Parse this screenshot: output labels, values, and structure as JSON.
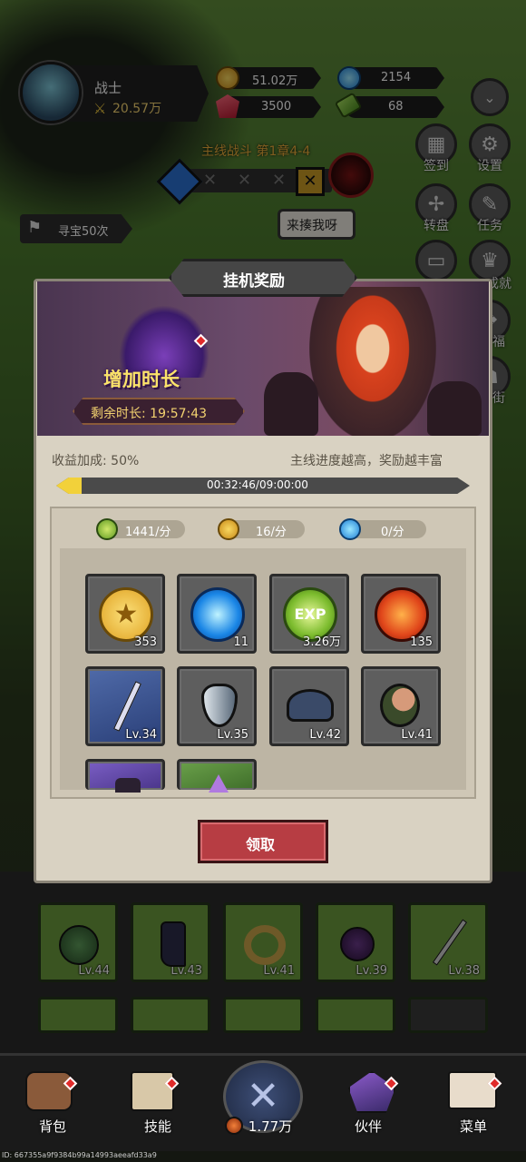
{
  "player": {
    "name": "战士",
    "power": "20.57万"
  },
  "currencies": {
    "gold": "51.02万",
    "diamond": "2154",
    "ruby": "3500",
    "stamina": "68"
  },
  "stage": {
    "title": "主线战斗 第1章4-4",
    "challenge_label": "来揍我呀"
  },
  "treasure": {
    "label": "寻宝50次"
  },
  "side_buttons": [
    {
      "label": "签到"
    },
    {
      "label": "设置"
    },
    {
      "label": "转盘"
    },
    {
      "label": "任务"
    },
    {
      "label": "成就"
    },
    {
      "label": "福"
    },
    {
      "label": "街"
    }
  ],
  "modal": {
    "title": "挂机奖励",
    "extend_label": "增加时长",
    "remaining_label": "剩余时长: 19:57:43",
    "bonus_label": "收益加成: 50%",
    "hint": "主线进度越高，奖励越丰富",
    "progress_text": "00:32:46/09:00:00",
    "progress": 0.061,
    "rates": [
      {
        "icon": "exp-icon",
        "value": "1441/分"
      },
      {
        "icon": "gold-coin-icon",
        "value": "16/分"
      },
      {
        "icon": "blue-gem-icon",
        "value": "0/分"
      }
    ],
    "items": [
      {
        "name": "gold-coin",
        "label": "353",
        "bg": "grey"
      },
      {
        "name": "blue-orb",
        "label": "11",
        "bg": "grey"
      },
      {
        "name": "exp-orb",
        "label": "3.26万",
        "bg": "grey"
      },
      {
        "name": "red-orb",
        "label": "135",
        "bg": "grey"
      },
      {
        "name": "sword",
        "label": "Lv.34",
        "bg": "blue"
      },
      {
        "name": "shield",
        "label": "Lv.35",
        "bg": "grey"
      },
      {
        "name": "helmet",
        "label": "Lv.42",
        "bg": "grey"
      },
      {
        "name": "boots",
        "label": "Lv.41",
        "bg": "grey"
      },
      {
        "name": "purple-item",
        "label": "",
        "bg": "purple"
      },
      {
        "name": "crystal-item",
        "label": "",
        "bg": "green"
      }
    ],
    "claim_label": "领取"
  },
  "inventory": {
    "items": [
      {
        "label": "Lv.44"
      },
      {
        "label": "Lv.43"
      },
      {
        "label": "Lv.41"
      },
      {
        "label": "Lv.39"
      },
      {
        "label": "Lv.38"
      }
    ]
  },
  "bottom_nav": [
    {
      "label": "背包"
    },
    {
      "label": "技能"
    },
    {
      "label": "1.77万"
    },
    {
      "label": "伙伴"
    },
    {
      "label": "菜单"
    }
  ],
  "debug_id": "ID: 667355a9f9384b99a14993aeeafd33a9",
  "colors": {
    "claim_button": "#b73d43",
    "progress_fill": "#f2d13a",
    "panel": "#d9d2c2"
  }
}
